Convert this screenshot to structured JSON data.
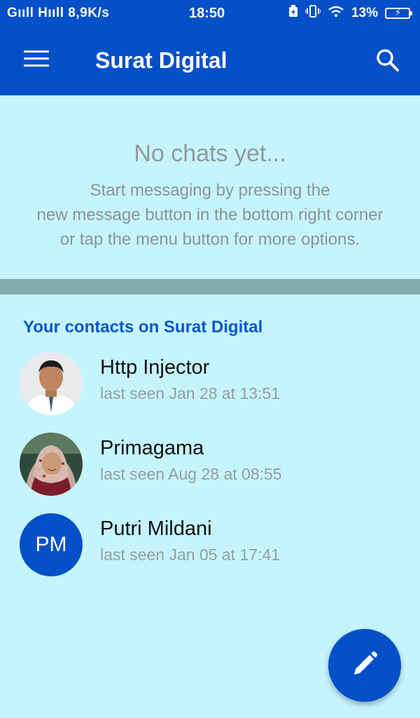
{
  "status_bar": {
    "signals": "Gııll Hııll",
    "speed": "8,9K/s",
    "time": "18:50",
    "battery_pct": "13%"
  },
  "app_bar": {
    "title": "Surat Digital",
    "menu_icon": "hamburger-menu-icon",
    "search_icon": "search-icon"
  },
  "empty_state": {
    "title": "No chats yet...",
    "line1": "Start messaging by pressing the",
    "line2": "new message button in the bottom right corner",
    "line3": "or tap the menu button for more options."
  },
  "contacts": {
    "header": "Your contacts on Surat Digital",
    "items": [
      {
        "name": "Http Injector",
        "status": "last seen Jan 28 at 13:51",
        "avatar": "photo"
      },
      {
        "name": "Primagama",
        "status": "last seen Aug 28 at 08:55",
        "avatar": "photo"
      },
      {
        "name": "Putri Mildani",
        "status": "last seen Jan 05 at 17:41",
        "avatar_initials": "PM"
      }
    ]
  },
  "fab": {
    "icon": "pencil-icon"
  },
  "colors": {
    "primary": "#0350c8",
    "background": "#c5f4fd",
    "divider": "#85aaab",
    "accent_text": "#0b55cc"
  }
}
